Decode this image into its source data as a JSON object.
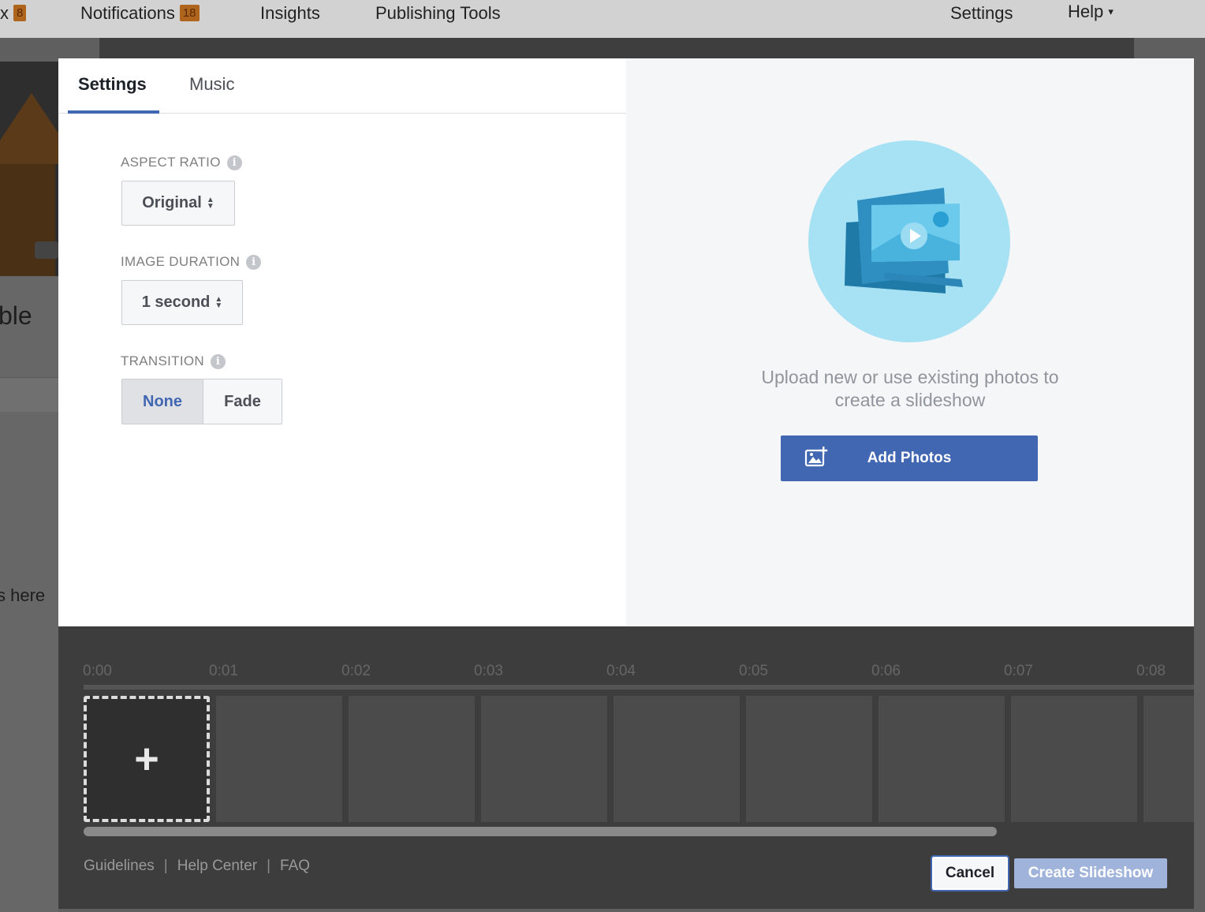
{
  "background": {
    "nav": {
      "inbox_fragment": "x",
      "inbox_badge": "8",
      "notifications": "Notifications",
      "notifications_badge": "18",
      "insights": "Insights",
      "publishing_tools": "Publishing Tools",
      "settings": "Settings",
      "help": "Help",
      "help_caret": "▾"
    },
    "left_text_1": "ble",
    "left_text_2": "s here"
  },
  "tabs": [
    {
      "label": "Settings",
      "active": true
    },
    {
      "label": "Music",
      "active": false
    }
  ],
  "settings": {
    "aspect_ratio": {
      "label": "ASPECT RATIO",
      "value": "Original"
    },
    "image_duration": {
      "label": "IMAGE DURATION",
      "value": "1 second"
    },
    "transition": {
      "label": "TRANSITION",
      "options": [
        "None",
        "Fade"
      ],
      "selected": "None"
    },
    "info_glyph": "i"
  },
  "preview": {
    "upload_line1": "Upload new or use existing photos to",
    "upload_line2": "create a slideshow",
    "add_photos_label": "Add Photos",
    "add_photos_icon": "add-photo-icon"
  },
  "timeline": {
    "ticks": [
      "0:00",
      "0:01",
      "0:02",
      "0:03",
      "0:04",
      "0:05",
      "0:06",
      "0:07",
      "0:08"
    ],
    "add_glyph": "+",
    "empty_slots": 9
  },
  "footer": {
    "links": [
      "Guidelines",
      "Help Center",
      "FAQ"
    ],
    "cancel_label": "Cancel",
    "create_label": "Create Slideshow"
  },
  "colors": {
    "accent": "#4267b2",
    "create_disabled": "#a0b4db",
    "illustration_circle": "#a7e1f4"
  }
}
